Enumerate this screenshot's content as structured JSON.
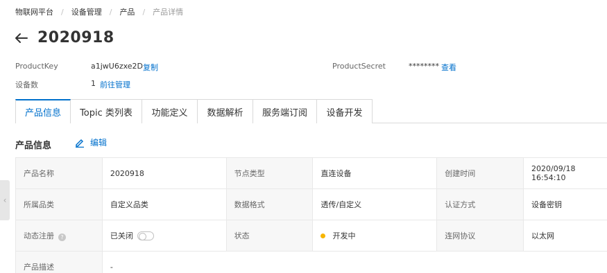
{
  "breadcrumb": [
    "物联网平台",
    "设备管理",
    "产品",
    "产品详情"
  ],
  "title": "2020918",
  "meta": {
    "product_key_label": "ProductKey",
    "product_key_value": "a1jwU6zxe2D",
    "copy_label": "复制",
    "product_secret_label": "ProductSecret",
    "product_secret_value": "********",
    "view_label": "查看",
    "device_count_label": "设备数",
    "device_count_value": "1",
    "manage_label": "前往管理"
  },
  "tabs": [
    "产品信息",
    "Topic 类列表",
    "功能定义",
    "数据解析",
    "服务端订阅",
    "设备开发"
  ],
  "section": {
    "title": "产品信息",
    "edit_label": "编辑"
  },
  "info": {
    "product_name_label": "产品名称",
    "product_name_value": "2020918",
    "node_type_label": "节点类型",
    "node_type_value": "直连设备",
    "created_label": "创建时间",
    "created_value": "2020/09/18 16:54:10",
    "category_label": "所属品类",
    "category_value": "自定义品类",
    "data_format_label": "数据格式",
    "data_format_value": "透传/自定义",
    "auth_label": "认证方式",
    "auth_value": "设备密钥",
    "dyn_reg_label": "动态注册",
    "dyn_reg_value": "已关闭",
    "status_label": "状态",
    "status_value": "开发中",
    "network_label": "连网协议",
    "network_value": "以太网",
    "desc_label": "产品描述",
    "desc_value": "-"
  },
  "colors": {
    "accent": "#0070cc",
    "status_dev": "#f7b500"
  }
}
